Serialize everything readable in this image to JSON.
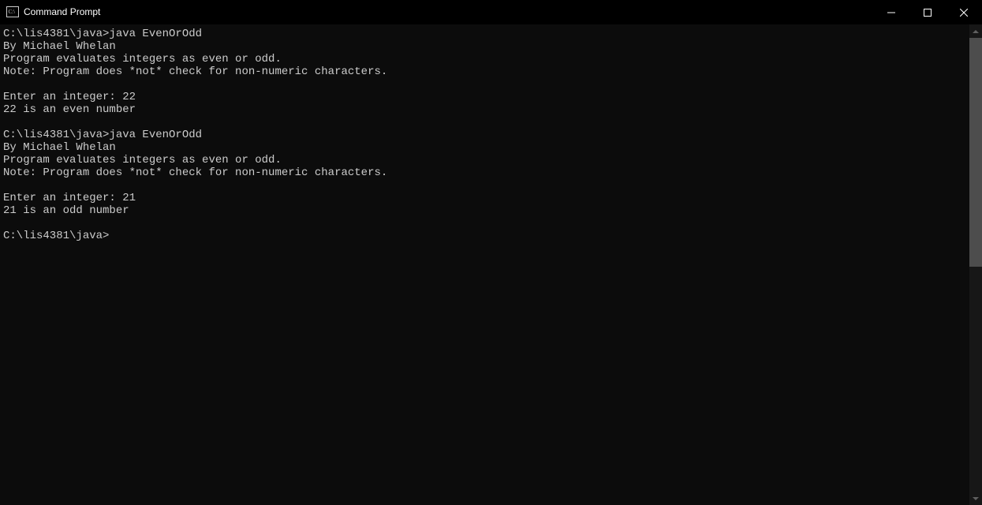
{
  "window": {
    "title": "Command Prompt"
  },
  "terminal": {
    "lines": [
      "C:\\lis4381\\java>java EvenOrOdd",
      "By Michael Whelan",
      "Program evaluates integers as even or odd.",
      "Note: Program does *not* check for non-numeric characters.",
      "",
      "Enter an integer: 22",
      "22 is an even number",
      "",
      "C:\\lis4381\\java>java EvenOrOdd",
      "By Michael Whelan",
      "Program evaluates integers as even or odd.",
      "Note: Program does *not* check for non-numeric characters.",
      "",
      "Enter an integer: 21",
      "21 is an odd number",
      "",
      "C:\\lis4381\\java>"
    ]
  }
}
